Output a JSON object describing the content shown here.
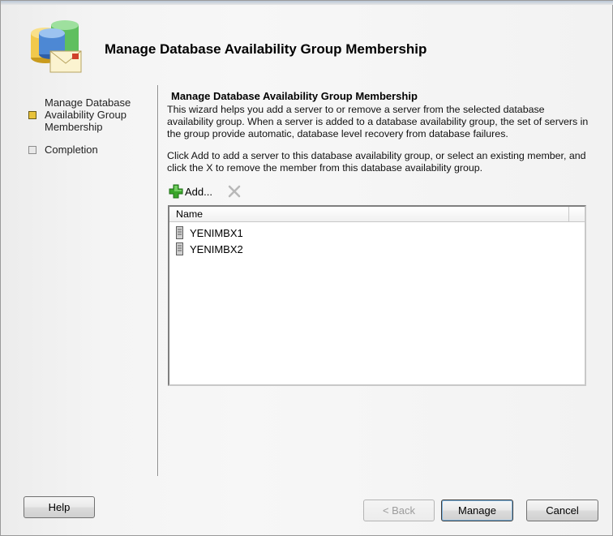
{
  "header": {
    "title": "Manage Database Availability Group Membership"
  },
  "steps": [
    {
      "label": "Manage Database Availability Group Membership",
      "state": "current"
    },
    {
      "label": "Completion",
      "state": "pending"
    }
  ],
  "content": {
    "title": "Manage Database Availability Group Membership",
    "description": "This wizard helps you add a server to or remove a server from the selected database availability group. When a server is added to a database availability group, the set of servers in the group provide automatic, database level recovery from database failures.",
    "instructions": "Click Add to add a server to this database availability group, or select an existing member, and click the X to remove the member from this database availability group.",
    "add_label": "Add..."
  },
  "list": {
    "columns": [
      "Name"
    ],
    "rows": [
      "YENIMBX1",
      "YENIMBX2"
    ]
  },
  "buttons": {
    "help": "Help",
    "back": "< Back",
    "manage": "Manage",
    "cancel": "Cancel"
  },
  "colors": {
    "current_step": "#e8c23a",
    "add_icon": "#3aa62a"
  }
}
